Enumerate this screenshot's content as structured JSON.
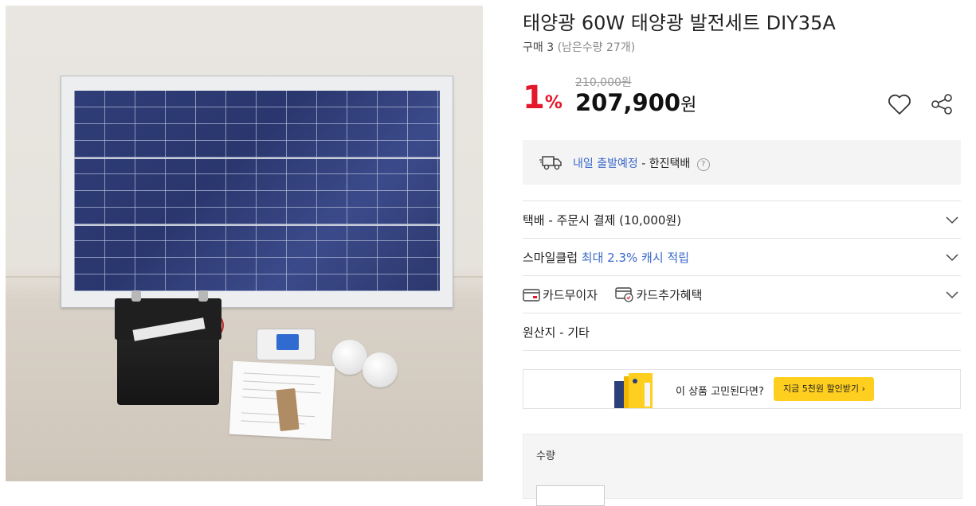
{
  "product": {
    "title": "태양광 60W 태양광 발전세트 DIY35A",
    "sold_label": "구매 3",
    "remaining_label": "(남은수량 27개)"
  },
  "pricing": {
    "discount_number": "1",
    "discount_unit": "%",
    "original_price": "210,000원",
    "sale_price": "207,900",
    "currency": "원"
  },
  "shipping": {
    "eta": "내일 출발예정",
    "carrier": "- 한진택배",
    "help_symbol": "?"
  },
  "options": {
    "delivery_fee": "택배 - 주문시 결제 (10,000원)",
    "smile_club_label": "스마일클럽",
    "smile_club_benefit": "최대 2.3% 캐시 적립",
    "card_interest_free": "카드무이자",
    "card_benefit": "카드추가혜택",
    "origin": "원산지 - 기타"
  },
  "promo": {
    "text": "이 상품 고민된다면?",
    "button_label": "지금 5천원 할인받기 ›"
  },
  "quantity": {
    "label": "수량"
  },
  "colors": {
    "discount": "#e5172b",
    "link_blue": "#3a68c9",
    "promo_button": "#ffcf1f"
  }
}
